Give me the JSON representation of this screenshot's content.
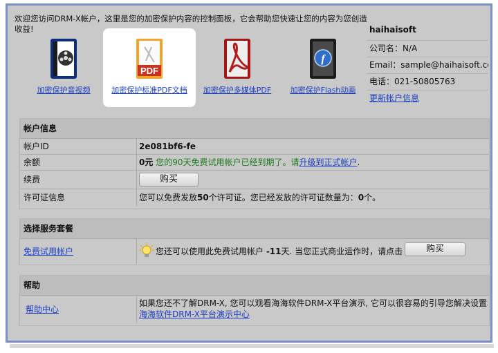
{
  "welcome": "欢迎您访问DRM-X帐户，这里是您的加密保护内容的控制面板，它会帮助您快速让您的内容为您创造收益!",
  "features": [
    {
      "label": "加密保护音视频",
      "icon": "video-film-icon"
    },
    {
      "label": "加密保护标准PDF文档",
      "icon": "pdf-document-icon"
    },
    {
      "label": "加密保护多媒体PDF",
      "icon": "acrobat-multimedia-icon"
    },
    {
      "label": "加密保护Flash动画",
      "icon": "flash-icon"
    }
  ],
  "user": {
    "name": "haihaisoft",
    "company": "公司名：N/A",
    "email": "Email：sample@haihaisoft.com",
    "phone": "电话：021-50805763",
    "update_link": "更新帐户信息"
  },
  "account": {
    "title": "帐户信息",
    "id_label": "帐户ID",
    "id_value": "2e081bf6-fe",
    "balance_label": "余额",
    "balance_value": "0元",
    "trial_msg": "您的90天免费试用帐户已经到期了。请",
    "upgrade_link": "升级到正式帐户",
    "renew_label": "续费",
    "buy_label": "购买",
    "license_label": "许可证信息",
    "license_pre": "您可以免费发放",
    "license_count": "50",
    "license_mid": "个许可证。您已经发放的许可证数量为：",
    "license_used": "0",
    "license_post": "个。"
  },
  "service": {
    "title": "选择服务套餐",
    "trial_link": "免费试用帐户",
    "msg_pre": "您还可以使用此免费试用帐户 ",
    "days": "-11",
    "msg_post": "天. 当您正式商业运作时，请点击",
    "buy_label": "购买"
  },
  "help": {
    "title": "帮助",
    "center_link": "帮助中心",
    "text": "如果您还不了解DRM-X, 您可以观看海海软件DRM-X平台演示, 它可以很容易的引导您解决设置和",
    "demo_link": "海海软件DRM-X平台演示中心"
  }
}
